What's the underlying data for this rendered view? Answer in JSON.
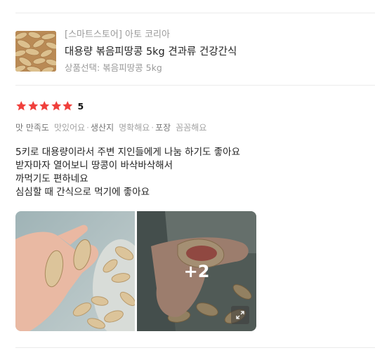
{
  "product": {
    "store": "[스마트스토어] 아토 코리아",
    "name": "대용량 볶음피땅콩 5kg 견과류 건강간식",
    "option": "상품선택: 볶음피땅콩 5kg"
  },
  "rating": {
    "stars": 5,
    "score": "5",
    "star_color": "#f0403c"
  },
  "tags": [
    {
      "key": "맛 만족도",
      "value": "맛있어요"
    },
    {
      "key": "생산지",
      "value": "명확해요"
    },
    {
      "key": "포장",
      "value": "꼼꼼해요"
    }
  ],
  "review": {
    "lines": [
      "5키로 대용량이라서 주변 지인들에게 나눔 하기도 좋아요",
      "받자마자 열어보니 땅콩이 바삭바삭해서",
      "까먹기도 편하네요",
      "심심할 때 간식으로 먹기에 좋아요"
    ]
  },
  "photos": {
    "more_count": "+2",
    "expand_icon": "expand-icon"
  }
}
